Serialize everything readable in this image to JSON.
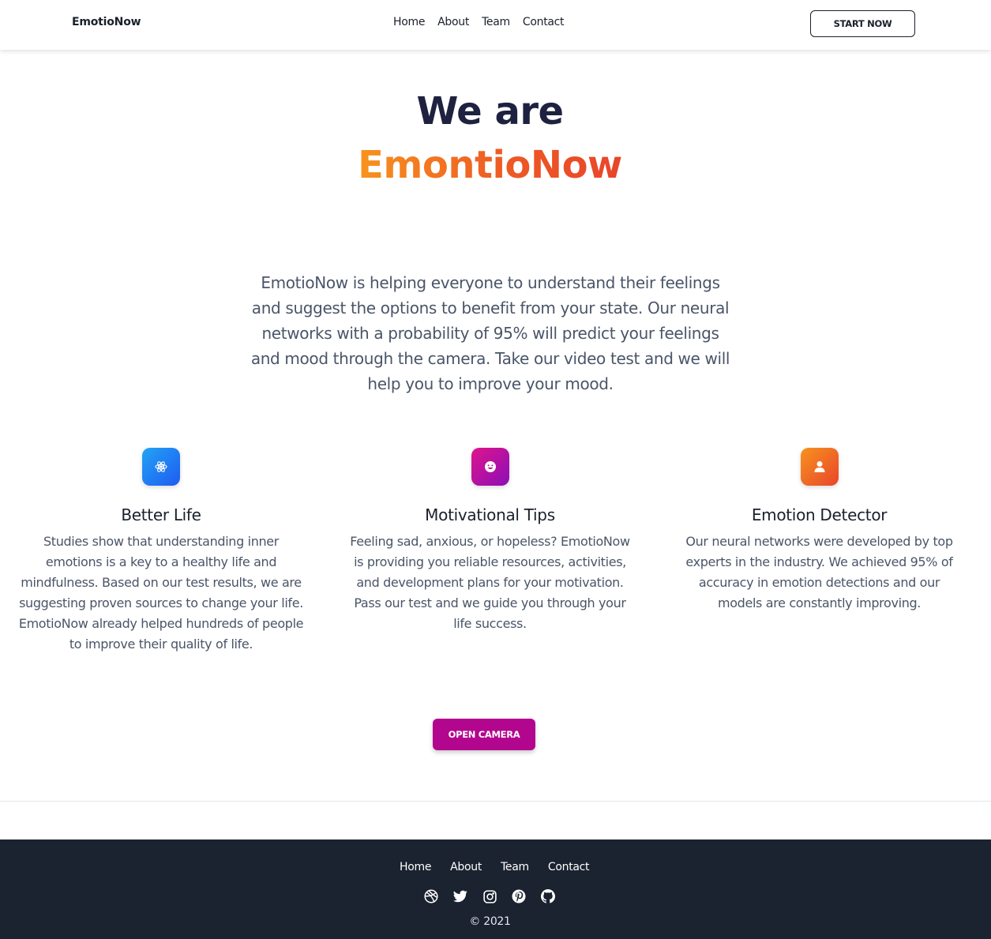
{
  "header": {
    "brand": "EmotioNow",
    "nav": [
      "Home",
      "About",
      "Team",
      "Contact"
    ],
    "cta_label": "START NOW"
  },
  "hero": {
    "line1": "We are",
    "line2": "EmontioNow",
    "description": "EmotioNow is helping everyone to understand their feelings and suggest the options to benefit from your state. Our neural networks with a probability of 95% will predict your feelings and mood through the camera. Take our video test and we will help you to improve your mood."
  },
  "features": [
    {
      "icon": "atom-icon",
      "title": "Better Life",
      "text": "Studies show that understanding inner emotions is a key to a healthy life and mindfulness. Based on our test results, we are suggesting proven sources to change your life. EmotioNow already helped hundreds of people to improve their quality of life.",
      "color": "#1f5bf2"
    },
    {
      "icon": "smile-icon",
      "title": "Motivational Tips",
      "text": "Feeling sad, anxious, or hopeless? EmotioNow is providing you reliable resources, activities, and development plans for your motivation. Pass our test and we guide you through your life success.",
      "color": "#b3068f"
    },
    {
      "icon": "user-icon",
      "title": "Emotion Detector",
      "text": "Our neural networks were developed by top experts in the industry. We achieved 95% of accuracy in emotion detections and our models are constantly improving.",
      "color": "#ee5a24"
    }
  ],
  "camera_button": "OPEN CAMERA",
  "footer": {
    "nav": [
      "Home",
      "About",
      "Team",
      "Contact"
    ],
    "socials": [
      "dribbble-icon",
      "twitter-icon",
      "instagram-icon",
      "pinterest-icon",
      "github-icon"
    ],
    "copyright": "© 2021",
    "background": "#1b2230"
  }
}
